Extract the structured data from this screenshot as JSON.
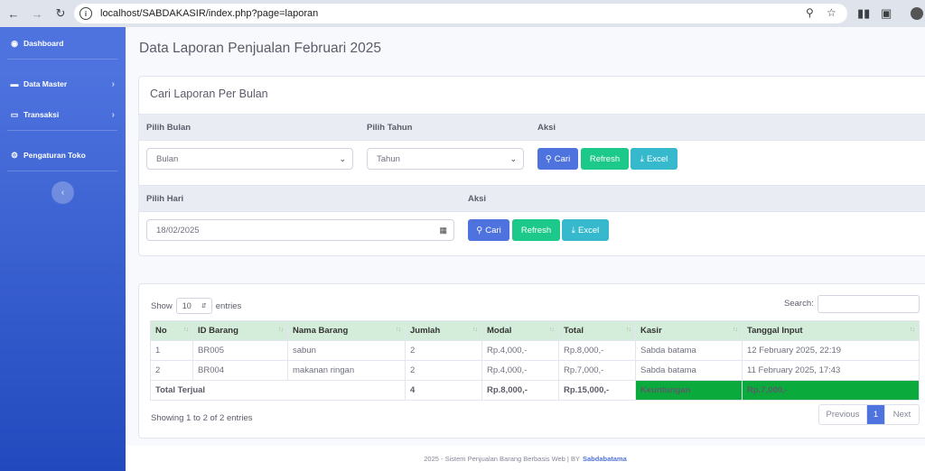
{
  "browser": {
    "url": "localhost/SABDAKASIR/index.php?page=laporan"
  },
  "sidebar": {
    "items": [
      {
        "label": "Dashboard",
        "icon": "tachometer-icon"
      },
      {
        "label": "Data Master",
        "icon": "database-icon"
      },
      {
        "label": "Transaksi",
        "icon": "desktop-icon"
      },
      {
        "label": "Pengaturan Toko",
        "icon": "cogs-icon"
      }
    ]
  },
  "page": {
    "title": "Data Laporan Penjualan Februari 2025"
  },
  "filter": {
    "card_title": "Cari Laporan Per Bulan",
    "month_header": "Pilih Bulan",
    "year_header": "Pilih Tahun",
    "action_header": "Aksi",
    "month_value": "Bulan",
    "year_value": "Tahun",
    "day_header": "Pilih Hari",
    "day_action_header": "Aksi",
    "day_value": "18/02/2025",
    "btn_search": "Cari",
    "btn_refresh": "Refresh",
    "btn_excel": "Excel"
  },
  "table": {
    "show_label": "Show",
    "length_value": "10",
    "entries_label": "entries",
    "search_label": "Search:",
    "columns": [
      "No",
      "ID Barang",
      "Nama Barang",
      "Jumlah",
      "Modal",
      "Total",
      "Kasir",
      "Tanggal Input"
    ],
    "rows": [
      [
        "1",
        "BR005",
        "sabun",
        "2",
        "Rp.4,000,-",
        "Rp.8,000,-",
        "Sabda batama",
        "12 February 2025, 22:19"
      ],
      [
        "2",
        "BR004",
        "makanan ringan",
        "2",
        "Rp.4,000,-",
        "Rp.7,000,-",
        "Sabda batama",
        "11 February 2025, 17:43"
      ]
    ],
    "total": {
      "label": "Total Terjual",
      "jumlah": "4",
      "modal": "Rp.8,000,-",
      "total": "Rp.15,000,-",
      "profit_label": "Keuntungan",
      "profit_value": "Rp.7,000,-"
    },
    "info": "Showing 1 to 2 of 2 entries",
    "pager": {
      "prev": "Previous",
      "current": "1",
      "next": "Next"
    }
  },
  "footer": {
    "text": "2025 - Sistem Penjualan Barang Berbasis Web | BY",
    "brand": "Sabdabatama"
  },
  "colors": {
    "sidebar_top": "#4e73df",
    "sidebar_bottom": "#224abe",
    "primary": "#4e73df",
    "success": "#1cc88a",
    "info": "#36b9cc",
    "profit_cell": "#0aab3c",
    "table_header": "#d4edda"
  }
}
